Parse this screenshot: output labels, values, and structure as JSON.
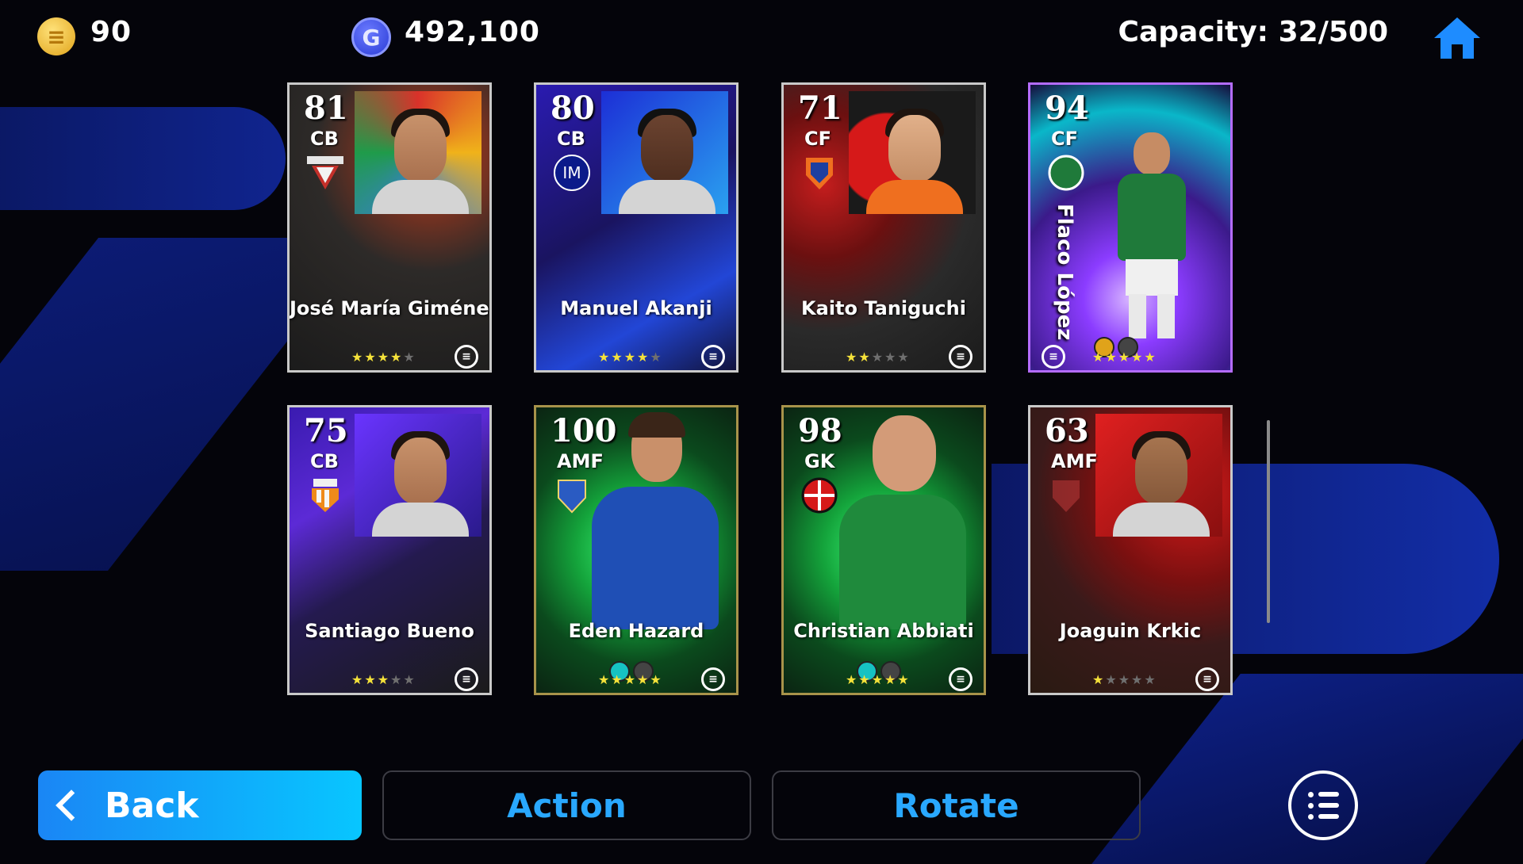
{
  "currency": {
    "coins": {
      "icon": "coin-icon",
      "value": "90"
    },
    "gp": {
      "icon": "gp-icon",
      "symbol": "G",
      "value": "492,100"
    }
  },
  "capacity": "Capacity: 32/500",
  "cards": [
    {
      "rating": "81",
      "position": "CB",
      "name": "José María Giménez",
      "stars": 4,
      "style": "standard"
    },
    {
      "rating": "80",
      "position": "CB",
      "name": "Manuel Akanji",
      "stars": 4,
      "style": "standard"
    },
    {
      "rating": "71",
      "position": "CF",
      "name": "Kaito Taniguchi",
      "stars": 2,
      "style": "standard"
    },
    {
      "rating": "94",
      "position": "CF",
      "name": "Flaco López",
      "stars": 5,
      "style": "featured"
    },
    {
      "rating": "75",
      "position": "CB",
      "name": "Santiago Bueno",
      "stars": 3,
      "style": "standard"
    },
    {
      "rating": "100",
      "position": "AMF",
      "name": "Eden Hazard",
      "stars": 5,
      "style": "epic"
    },
    {
      "rating": "98",
      "position": "GK",
      "name": "Christian Abbiati",
      "stars": 5,
      "style": "epic"
    },
    {
      "rating": "63",
      "position": "AMF",
      "name": "Joaguin Krkic",
      "stars": 1,
      "style": "standard"
    }
  ],
  "buttons": {
    "back": "Back",
    "action": "Action",
    "rotate": "Rotate"
  },
  "colors": {
    "accent": "#29a8ff",
    "star_on": "#f5e23a",
    "star_off": "#6f6f6f"
  }
}
